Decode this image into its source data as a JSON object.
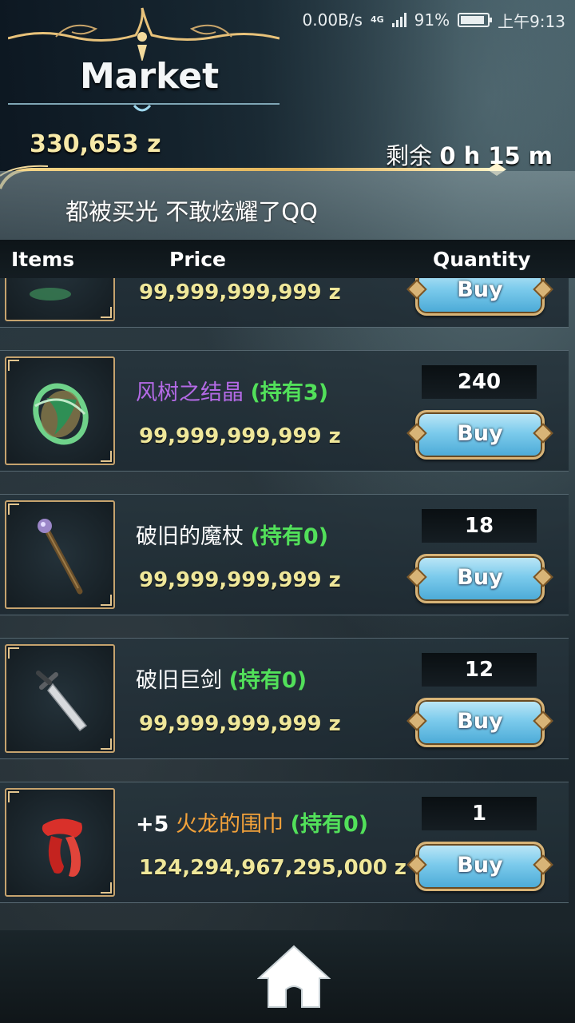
{
  "status_bar": {
    "speed": "0.00B/s",
    "network": "4G",
    "battery": "91%",
    "time": "上午9:13"
  },
  "header": {
    "title": "Market",
    "money": "330,653 z",
    "timer_label": "剩余",
    "timer_value": "0 h 15 m",
    "announcement": "都被买光 不敢炫耀了QQ"
  },
  "columns": {
    "items": "Items",
    "price": "Price",
    "quantity": "Quantity"
  },
  "rows": [
    {
      "icon": "green-leaf-icon",
      "price": "99,999,999,999 z",
      "buy_label": "Buy"
    },
    {
      "icon": "wind-crystal-icon",
      "name": "风树之结晶",
      "held": "(持有3)",
      "price": "99,999,999,999 z",
      "quantity": "240",
      "buy_label": "Buy"
    },
    {
      "icon": "magic-staff-icon",
      "name": "破旧的魔杖",
      "held": "(持有0)",
      "price": "99,999,999,999 z",
      "quantity": "18",
      "buy_label": "Buy"
    },
    {
      "icon": "greatsword-icon",
      "name": "破旧巨剑",
      "held": "(持有0)",
      "price": "99,999,999,999 z",
      "quantity": "12",
      "buy_label": "Buy"
    },
    {
      "icon": "red-scarf-icon",
      "prefix": "+5",
      "name": "火龙的围巾",
      "held": "(持有0)",
      "price": "124,294,967,295,000 z",
      "quantity": "1",
      "buy_label": "Buy"
    }
  ],
  "colors": {
    "gold": "#e8c27a",
    "price": "#efe79a",
    "held": "#52e05a",
    "purple_name": "#b46ae6",
    "orange_name": "#f3a23a"
  },
  "bottom_bar": {
    "icon": "home-icon"
  }
}
